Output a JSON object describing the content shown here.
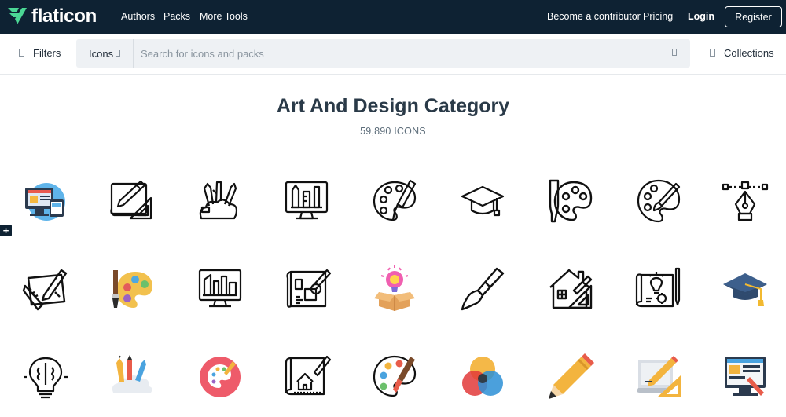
{
  "header": {
    "brand": "flaticon",
    "nav": [
      "Authors",
      "Packs",
      "More Tools"
    ],
    "contributor": "Become a contributor",
    "pricing": "Pricing",
    "login": "Login",
    "register": "Register"
  },
  "search": {
    "filters_label": "Filters",
    "type_selected": "Icons",
    "placeholder": "Search for icons and packs",
    "collections_label": "Collections"
  },
  "main": {
    "title": "Art And Design Category",
    "count": "59,890 ICONS"
  },
  "icons": [
    "web-design-icon",
    "drafting-icon",
    "art-supplies-icon",
    "design-monitor-icon",
    "palette-brush-icon",
    "graduation-cap-icon",
    "palette-icon",
    "palette-outline-icon",
    "pen-tool-icon",
    "design-tablet-icon",
    "color-palette-icon",
    "monitor-city-icon",
    "blueprint-icon",
    "creative-box-icon",
    "paint-brush-icon",
    "architecture-icon",
    "idea-blueprint-icon",
    "mortarboard-icon",
    "brain-bulb-icon",
    "pencils-cup-icon",
    "palette-circle-icon",
    "house-blueprint-icon",
    "paint-palette-icon",
    "color-circles-icon",
    "pencil-icon",
    "drawing-board-icon",
    "monitor-design-icon"
  ],
  "colors": {
    "topbar": "#0e2233",
    "brand_green": "#4bd795",
    "title": "#2a3a48"
  }
}
